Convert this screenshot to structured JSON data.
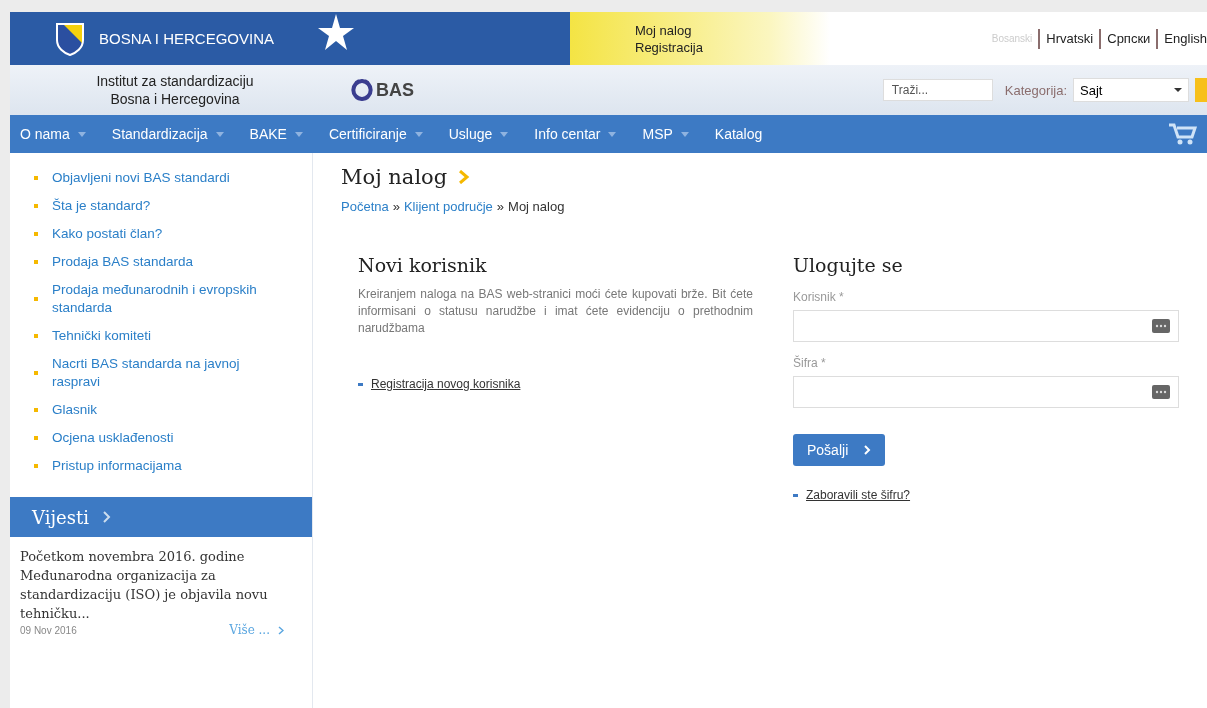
{
  "header": {
    "country": "BOSNA I HERCEGOVINA",
    "account_links": [
      "Moj nalog",
      "Registracija"
    ],
    "languages": [
      {
        "label": "Bosanski",
        "selected": true
      },
      {
        "label": "Hrvatski",
        "selected": false
      },
      {
        "label": "Српски",
        "selected": false
      },
      {
        "label": "English",
        "selected": false
      }
    ],
    "institute_line_1": "Institut za standardizaciju",
    "institute_line_2": "Bosna i Hercegovina",
    "logo_text": "BAS",
    "search": {
      "placeholder": "Traži..."
    },
    "category_label": "Kategorija:",
    "category_value": "Sajt"
  },
  "nav": [
    {
      "label": "O nama",
      "dropdown": true
    },
    {
      "label": "Standardizacija",
      "dropdown": true
    },
    {
      "label": "BAKE",
      "dropdown": true
    },
    {
      "label": "Certificiranje",
      "dropdown": true
    },
    {
      "label": "Usluge",
      "dropdown": true
    },
    {
      "label": "Info centar",
      "dropdown": true
    },
    {
      "label": "MSP",
      "dropdown": true
    },
    {
      "label": "Katalog",
      "dropdown": false
    }
  ],
  "sidebar": {
    "links": [
      "Objavljeni novi BAS standardi",
      "Šta je standard?",
      "Kako postati član?",
      "Prodaja BAS standarda",
      "Prodaja međunarodnih i evropskih standarda",
      "Tehnički komiteti",
      "Nacrti BAS standarda na javnoj raspravi",
      "Glasnik",
      "Ocjena usklađenosti",
      "Pristup informacijama"
    ],
    "news_title": "Vijesti",
    "news": [
      {
        "text": "Početkom novembra 2016. godine Međunarodna organizacija za standardizaciju (ISO) je objavila novu tehničku...",
        "date": "09 Nov 2016",
        "more": "Više ..."
      }
    ]
  },
  "main": {
    "title": "Moj nalog",
    "breadcrumb_separator": "»",
    "breadcrumb": [
      {
        "label": "Početna",
        "current": false
      },
      {
        "label": "Klijent područje",
        "current": false
      },
      {
        "label": "Moj nalog",
        "current": true
      }
    ],
    "new_user": {
      "title": "Novi korisnik",
      "text": "Kreiranjem naloga na BAS web-stranici moći ćete kupovati brže. Bit ćete informisani o statusu narudžbe i imat ćete evidenciju o prethodnim narudžbama",
      "link": "Registracija novog korisnika"
    },
    "login": {
      "title": "Ulogujte se",
      "fields": [
        {
          "label": "Korisnik *"
        },
        {
          "label": "Šifra *"
        }
      ],
      "submit": "Pošalji",
      "forgot": "Zaboravili ste šifru?"
    }
  }
}
